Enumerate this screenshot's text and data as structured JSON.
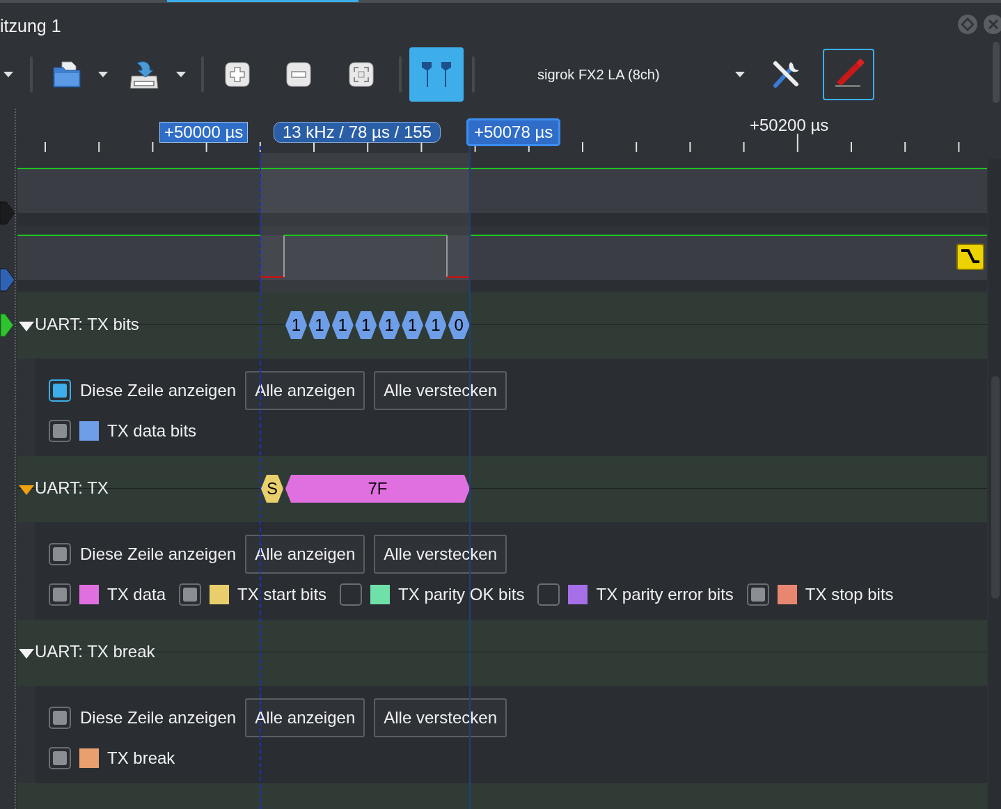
{
  "window": {
    "title": "itzung 1"
  },
  "toolbar": {
    "cursor_toggle_on": true,
    "device": "sigrok FX2 LA (8ch)",
    "probe_selected": true
  },
  "ruler": {
    "label": "+50200 µs"
  },
  "cursors": {
    "left": "+50000 µs",
    "middle": "13 kHz / 78 µs / 155",
    "right": "+50078 µs"
  },
  "channels": [
    {
      "color": "#1a1c1e"
    },
    {
      "color": "#2f63b5"
    }
  ],
  "decoders": [
    {
      "title": "UART: TX bits",
      "selected": false,
      "color": "#2fc42f",
      "annotations": [
        {
          "text": "1",
          "color": "#6f9ee8"
        },
        {
          "text": "1",
          "color": "#6f9ee8"
        },
        {
          "text": "1",
          "color": "#6f9ee8"
        },
        {
          "text": "1",
          "color": "#6f9ee8"
        },
        {
          "text": "1",
          "color": "#6f9ee8"
        },
        {
          "text": "1",
          "color": "#6f9ee8"
        },
        {
          "text": "1",
          "color": "#6f9ee8"
        },
        {
          "text": "0",
          "color": "#6f9ee8"
        }
      ],
      "show_row": {
        "label": "Diese Zeile anzeigen",
        "checked": true,
        "focused": true
      },
      "buttons": [
        "Alle anzeigen",
        "Alle verstecken"
      ],
      "classes": [
        {
          "label": "TX data bits",
          "color": "#6f9ee8",
          "checked": true
        }
      ]
    },
    {
      "title": "UART: TX",
      "selected": true,
      "annotations": [
        {
          "text": "S",
          "color": "#e9cf6c"
        },
        {
          "text": "7F",
          "color": "#e070e0"
        }
      ],
      "show_row": {
        "label": "Diese Zeile anzeigen",
        "checked": true,
        "focused": false
      },
      "buttons": [
        "Alle anzeigen",
        "Alle verstecken"
      ],
      "classes": [
        {
          "label": "TX data",
          "color": "#e070e0",
          "checked": true
        },
        {
          "label": "TX start bits",
          "color": "#e9cf6c",
          "checked": true
        },
        {
          "label": "TX parity OK bits",
          "color": "#6fe0a8",
          "checked": false
        },
        {
          "label": "TX parity error bits",
          "color": "#a56fe8",
          "checked": false
        },
        {
          "label": "TX stop bits",
          "color": "#e8876f",
          "checked": true
        }
      ]
    },
    {
      "title": "UART: TX break",
      "selected": false,
      "show_row": {
        "label": "Diese Zeile anzeigen",
        "checked": true,
        "focused": false
      },
      "buttons": [
        "Alle anzeigen",
        "Alle verstecken"
      ],
      "classes": [
        {
          "label": "TX break",
          "color": "#e8a06f",
          "checked": true
        }
      ]
    }
  ]
}
